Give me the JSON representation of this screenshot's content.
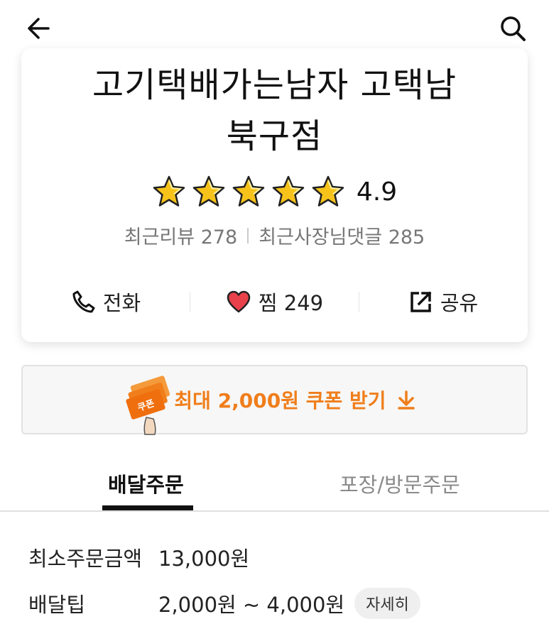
{
  "store": {
    "name_line1": "고기택배가는남자 고택남",
    "name_line2": "북구점",
    "rating": "4.9",
    "stars_filled": 5,
    "recent_reviews": "최근리뷰 278",
    "recent_owner_replies": "최근사장님댓글 285"
  },
  "actions": {
    "call_label": "전화",
    "like_label": "찜 249",
    "share_label": "공유"
  },
  "coupon": {
    "label": "최대 2,000원 쿠폰 받기",
    "icon_text": "쿠폰"
  },
  "tabs": [
    {
      "label": "배달주문",
      "active": true
    },
    {
      "label": "포장/방문주문",
      "active": false
    }
  ],
  "info": {
    "min_order_label": "최소주문금액",
    "min_order_value": "13,000원",
    "delivery_tip_label": "배달팁",
    "delivery_tip_value": "2,000원 ~ 4,000원",
    "detail_button": "자세히"
  },
  "colors": {
    "accent_orange": "#f07e1b",
    "heart_red": "#e8414b",
    "star_gold": "#f7c31a"
  }
}
